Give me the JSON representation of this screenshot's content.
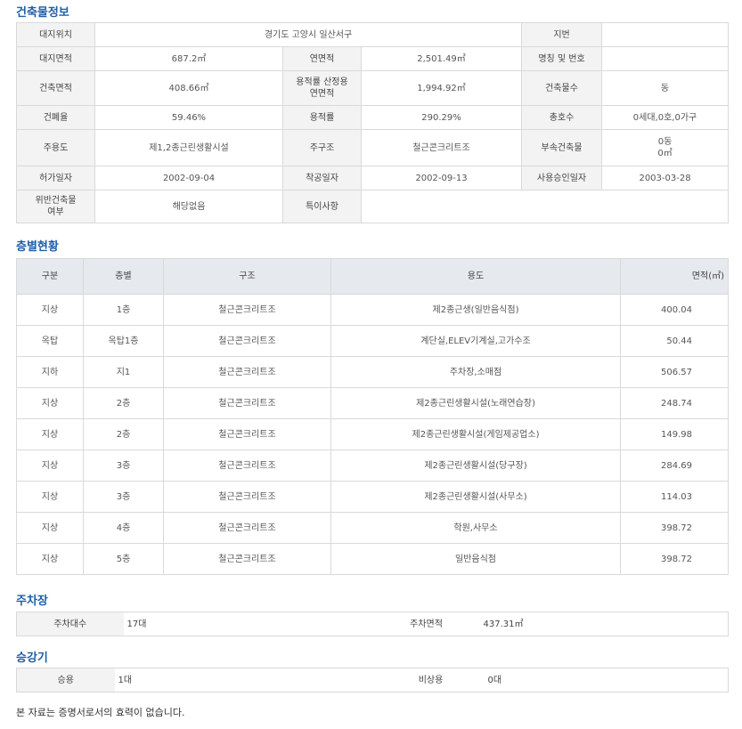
{
  "building": {
    "title": "건축물정보",
    "rows": [
      [
        {
          "l": "대지위치",
          "v": "경기도 고양시 일산서구",
          "span": 3
        },
        {
          "l": "지번",
          "v": ""
        }
      ],
      [
        {
          "l": "대지면적",
          "v": "687.2㎡"
        },
        {
          "l": "연면적",
          "v": "2,501.49㎡"
        },
        {
          "l": "명칭 및 번호",
          "v": ""
        }
      ],
      [
        {
          "l": "건축면적",
          "v": "408.66㎡"
        },
        {
          "l": "용적률 산정용\n연면적",
          "v": "1,994.92㎡"
        },
        {
          "l": "건축물수",
          "v": "동"
        }
      ],
      [
        {
          "l": "건폐율",
          "v": "59.46%"
        },
        {
          "l": "용적률",
          "v": "290.29%"
        },
        {
          "l": "총호수",
          "v": "0세대,0호,0가구"
        }
      ],
      [
        {
          "l": "주용도",
          "v": "제1,2종근린생활시설"
        },
        {
          "l": "주구조",
          "v": "철근콘크리트조"
        },
        {
          "l": "부속건축물",
          "v": "0동\n0㎡"
        }
      ],
      [
        {
          "l": "허가일자",
          "v": "2002-09-04"
        },
        {
          "l": "착공일자",
          "v": "2002-09-13"
        },
        {
          "l": "사용승인일자",
          "v": "2003-03-28"
        }
      ],
      [
        {
          "l": "위반건축물\n여부",
          "v": "해당없음"
        },
        {
          "l": "특이사항",
          "v": "",
          "span": 3
        }
      ]
    ]
  },
  "floors": {
    "title": "층별현황",
    "headers": [
      "구분",
      "층별",
      "구조",
      "용도",
      "면적(㎡)"
    ],
    "rows": [
      [
        "지상",
        "1층",
        "철근콘크리트조",
        "제2종근생(일반음식점)",
        "400.04"
      ],
      [
        "옥탑",
        "옥탑1층",
        "철근콘크리트조",
        "계단실,ELEV기계실,고가수조",
        "50.44"
      ],
      [
        "지하",
        "지1",
        "철근콘크리트조",
        "주차장,소매점",
        "506.57"
      ],
      [
        "지상",
        "2층",
        "철근콘크리트조",
        "제2종근린생활시설(노래연습장)",
        "248.74"
      ],
      [
        "지상",
        "2층",
        "철근콘크리트조",
        "제2종근린생활시설(게임제공업소)",
        "149.98"
      ],
      [
        "지상",
        "3층",
        "철근콘크리트조",
        "제2종근린생활시설(당구장)",
        "284.69"
      ],
      [
        "지상",
        "3층",
        "철근콘크리트조",
        "제2종근린생활시설(사무소)",
        "114.03"
      ],
      [
        "지상",
        "4층",
        "철근콘크리트조",
        "학원,사무소",
        "398.72"
      ],
      [
        "지상",
        "5층",
        "철근콘크리트조",
        "일반음식점",
        "398.72"
      ]
    ]
  },
  "parking": {
    "title": "주차장",
    "count_label": "주차대수",
    "count_value": "17대",
    "area_label": "주차면적",
    "area_value": "437.31㎡"
  },
  "elevator": {
    "title": "승강기",
    "passenger_label": "승용",
    "passenger_value": "1대",
    "emergency_label": "비상용",
    "emergency_value": "0대"
  },
  "note": "본 자료는 증명서로서의 효력이 없습니다."
}
